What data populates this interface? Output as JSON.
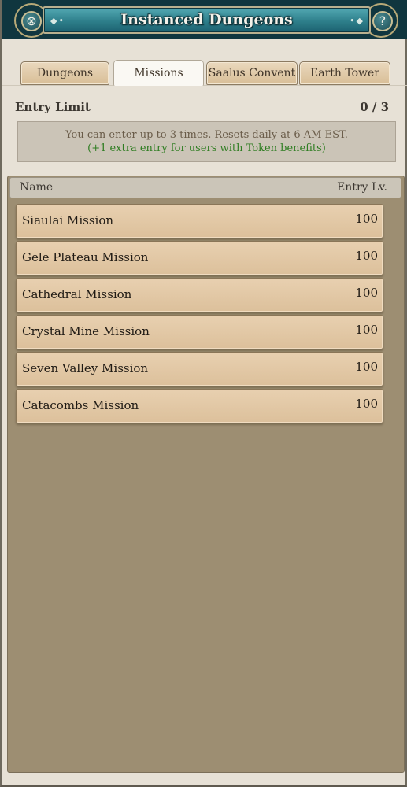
{
  "window": {
    "title": "Instanced Dungeons",
    "close_icon": "close-icon",
    "help_icon": "help-icon",
    "help_glyph": "?",
    "close_glyph": "⊗"
  },
  "tabs": [
    {
      "label": "Dungeons",
      "active": false
    },
    {
      "label": "Missions",
      "active": true
    },
    {
      "label": "Saalus Convent",
      "active": false
    },
    {
      "label": "Earth Tower",
      "active": false
    }
  ],
  "entry_limit": {
    "label": "Entry Limit",
    "count": "0 / 3",
    "info_line1": "You can enter up to 3 times. Resets daily at 6 AM EST.",
    "info_line2": "(+1 extra entry for users with Token benefits)",
    "info_line2_color": "#2f7d22"
  },
  "list": {
    "columns": {
      "name": "Name",
      "level": "Entry Lv."
    },
    "rows": [
      {
        "name": "Siaulai Mission",
        "level": "100"
      },
      {
        "name": "Gele Plateau Mission",
        "level": "100"
      },
      {
        "name": "Cathedral Mission",
        "level": "100"
      },
      {
        "name": "Crystal Mine Mission",
        "level": "100"
      },
      {
        "name": "Seven Valley Mission",
        "level": "100"
      },
      {
        "name": "Catacombs Mission",
        "level": "100"
      }
    ]
  }
}
